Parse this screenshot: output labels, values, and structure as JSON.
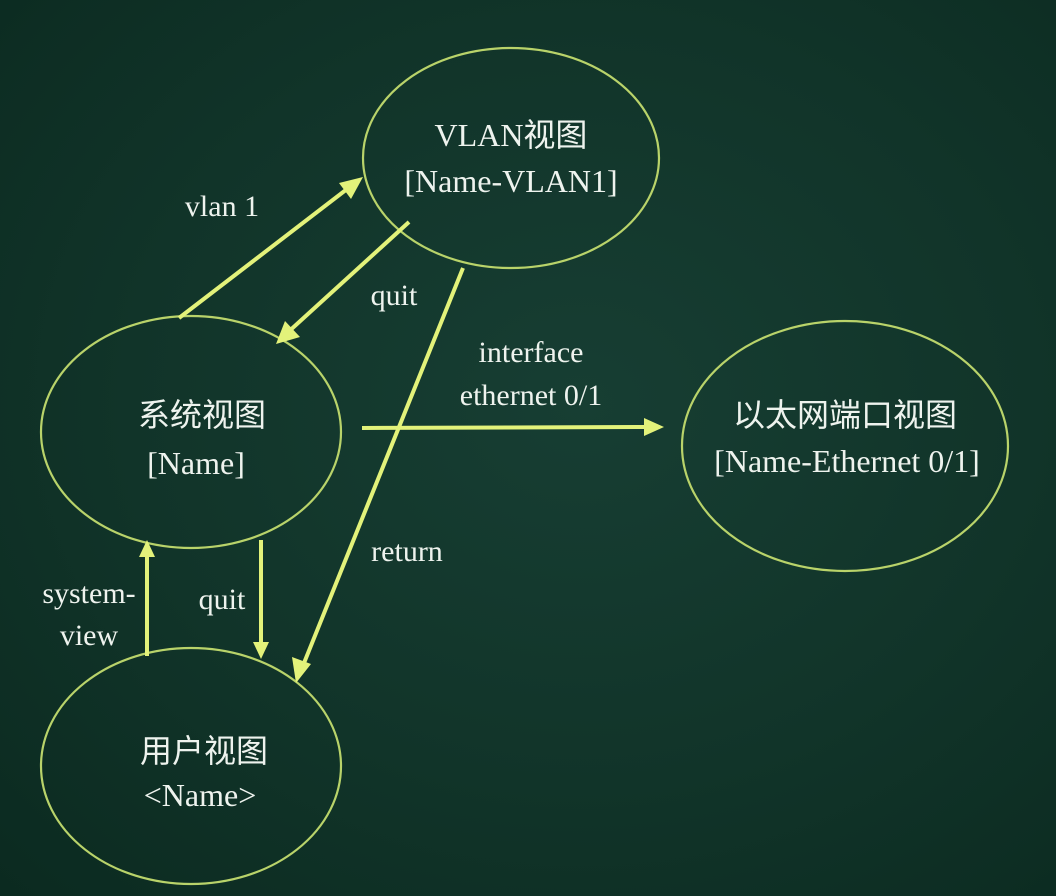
{
  "nodes": {
    "vlan": {
      "line1": "VLAN视图",
      "line2": "[Name-VLAN1]"
    },
    "system": {
      "line1": "系统视图",
      "line2": "[Name]"
    },
    "user": {
      "line1": "用户视图",
      "line2": "<Name>"
    },
    "ethernet": {
      "line1": "以太网端口视图",
      "line2": "[Name-Ethernet 0/1]"
    }
  },
  "edges": {
    "vlan1": {
      "label": "vlan 1"
    },
    "quit_vlan": {
      "label": "quit"
    },
    "interface": {
      "line1": "interface",
      "line2": "ethernet 0/1"
    },
    "return": {
      "label": "return"
    },
    "system_view": {
      "line1": "system-",
      "line2": "view"
    },
    "quit_system": {
      "label": "quit"
    }
  },
  "colors": {
    "background": "#113429",
    "ellipse_stroke": "#b9d36a",
    "arrow": "#e3f27a",
    "text": "#eef3ee"
  }
}
